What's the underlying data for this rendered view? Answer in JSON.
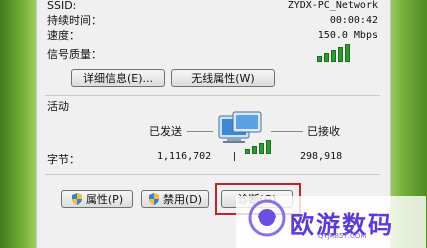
{
  "connection": {
    "ssid_label": "SSID:",
    "ssid_value": "ZYDX-PC_Network",
    "duration_label": "持续时间：",
    "duration_value": "00:00:42",
    "speed_label": "速度：",
    "speed_value": "150.0 Mbps",
    "signal_label": "信号质量：",
    "signal_level": 5,
    "signal_max": 5
  },
  "buttons": {
    "details": "详细信息(E)...",
    "wireless_properties": "无线属性(W)",
    "properties": "属性(P)",
    "disable": "禁用(D)",
    "diagnose": "诊断(G)"
  },
  "activity": {
    "title": "活动",
    "sent_label": "已发送",
    "received_label": "已接收",
    "bytes_label": "字节：",
    "sent_value": "1,116,702",
    "received_value": "298,918"
  },
  "watermark": {
    "text": "欧游数码",
    "sub": "QYJK857.COM"
  },
  "colors": {
    "signal": "#2f9b2f",
    "highlight": "#c0232b",
    "brand": "#5b3ad6"
  }
}
